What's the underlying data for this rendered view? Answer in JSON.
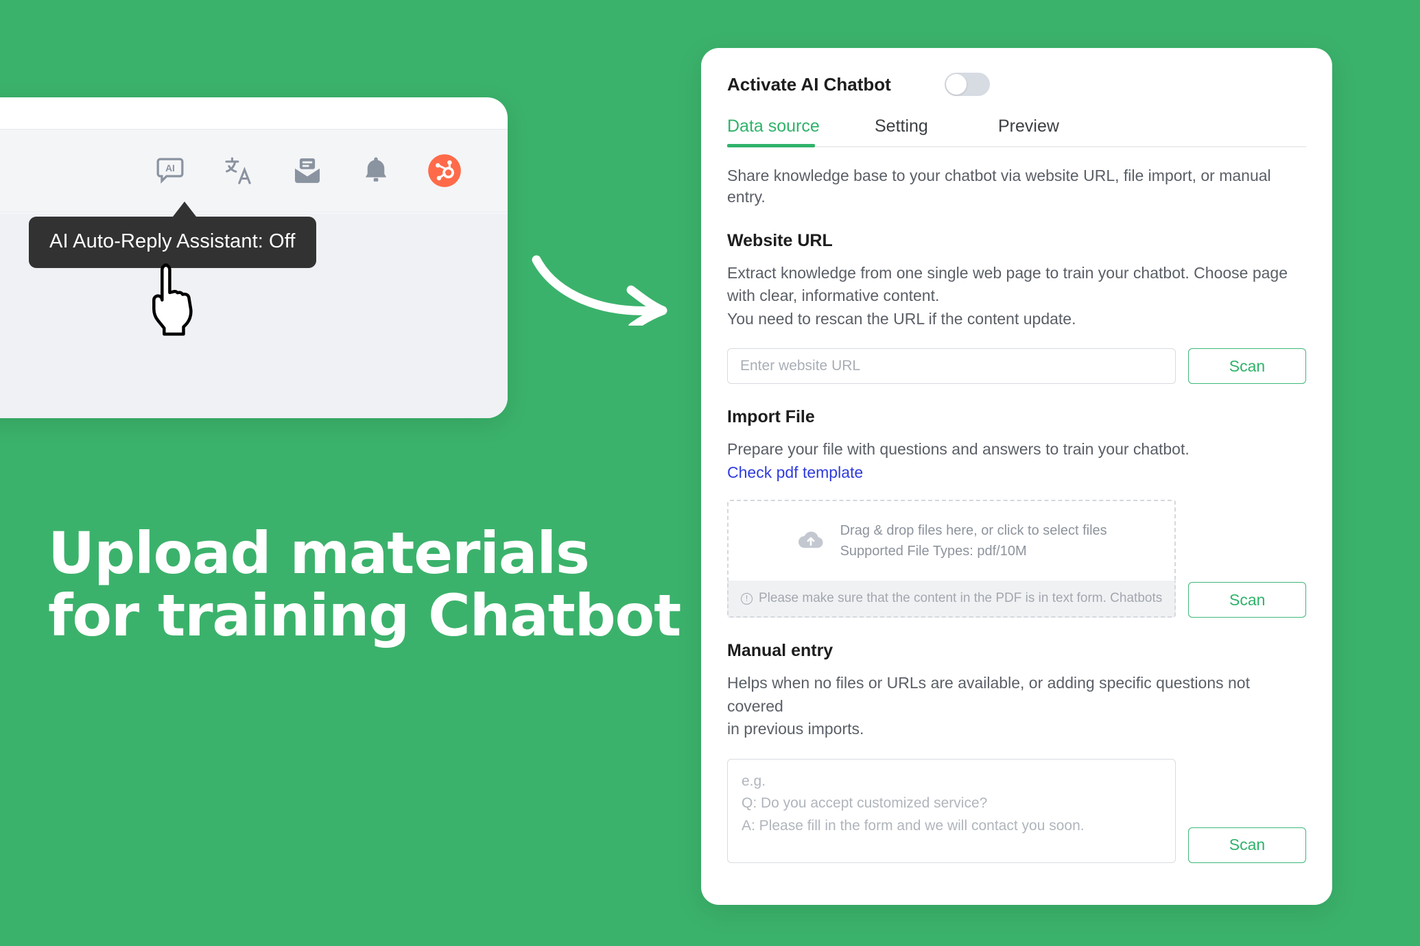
{
  "theme": {
    "background_green": "#3bb26b",
    "accent_green": "#2fb36a",
    "link_blue": "#2f3bdd",
    "hubspot_orange": "#ff6b4a",
    "tooltip_dark": "#323232"
  },
  "left_panel": {
    "toolbar_icons": [
      {
        "name": "ai-assistant-icon",
        "label": "AI"
      },
      {
        "name": "translate-icon",
        "label": "translate"
      },
      {
        "name": "mail-icon",
        "label": "inbox"
      },
      {
        "name": "bell-icon",
        "label": "notifications"
      },
      {
        "name": "hubspot-icon",
        "label": "HubSpot"
      }
    ],
    "tooltip": {
      "text": "AI Auto-Reply Assistant: Off"
    },
    "cursor": "hand-pointer-cursor"
  },
  "headline": {
    "line1": "Upload materials",
    "line2": "for training Chatbot"
  },
  "arrow": {
    "name": "curved-arrow-right"
  },
  "chatbot_card": {
    "activate": {
      "label": "Activate AI Chatbot",
      "toggle_state": "off"
    },
    "tabs": [
      {
        "label": "Data source",
        "active": true
      },
      {
        "label": "Setting",
        "active": false
      },
      {
        "label": "Preview",
        "active": false
      }
    ],
    "intro": "Share knowledge base to your chatbot via website URL, file import, or manual entry.",
    "website_url": {
      "title": "Website URL",
      "description_line1": "Extract knowledge from one single web page to train your chatbot. Choose page",
      "description_line2": "with clear, informative content.",
      "description_line3": "You need to rescan the URL if the content update.",
      "input_value": "",
      "input_placeholder": "Enter website URL",
      "scan_label": "Scan"
    },
    "import_file": {
      "title": "Import File",
      "description": "Prepare your file with questions and answers to train your chatbot.",
      "template_link": "Check pdf template",
      "dropzone_line1": "Drag & drop files here, or click to select files",
      "dropzone_line2": "Supported File Types: pdf/10M",
      "warning": "Please make sure that the content in the PDF is in text form. Chatbots",
      "scan_label": "Scan"
    },
    "manual_entry": {
      "title": "Manual entry",
      "description_line1": "Helps when no files or URLs are available, or adding specific questions not covered",
      "description_line2": "in previous imports.",
      "textarea_value": "",
      "textarea_placeholder": "e.g.\nQ: Do you accept customized service?\nA: Please fill in the form and we will contact you soon.",
      "scan_label": "Scan"
    }
  }
}
